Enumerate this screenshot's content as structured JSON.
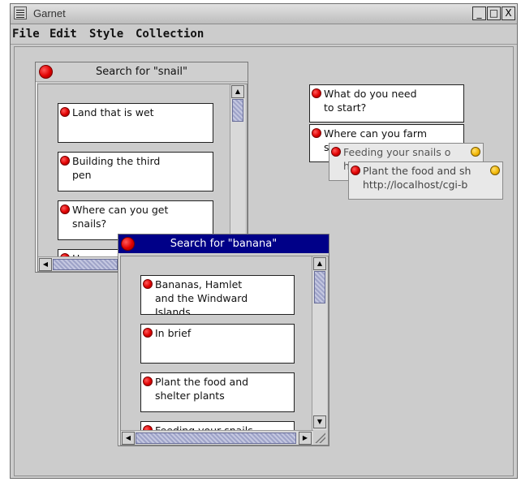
{
  "window": {
    "title": "Garnet",
    "minimize": "_",
    "maximize": "□",
    "close": "X"
  },
  "menubar": {
    "items": [
      "File",
      "Edit",
      "Style",
      "Collection"
    ]
  },
  "snail_search": {
    "title": "Search for \"snail\"",
    "cards": [
      "Land that is wet",
      "Building the third\npen",
      "Where can you get\nsnails?",
      "How m..."
    ]
  },
  "banana_search": {
    "title": "Search for \"banana\"",
    "cards": [
      "Bananas, Hamlet\nand the Windward\nIslands",
      "In brief",
      "Plant the food and\nshelter plants",
      "Feeding your snails"
    ]
  },
  "loose_cards": [
    {
      "text": "What do you need\nto start?"
    },
    {
      "text": "Where can you farm\nsnails?"
    },
    {
      "text": "Feeding your snails o\nhttp://localhost/cgi-b"
    },
    {
      "text": "Plant the food and sh\nhttp://localhost/cgi-b"
    }
  ],
  "icons": {
    "red_dot": "red-circle-icon",
    "yellow_dot": "yellow-circle-icon"
  },
  "colors": {
    "active_title": "#000088",
    "dot_red": "#e00000",
    "dot_yellow": "#f0b400",
    "background": "#cccccc"
  }
}
